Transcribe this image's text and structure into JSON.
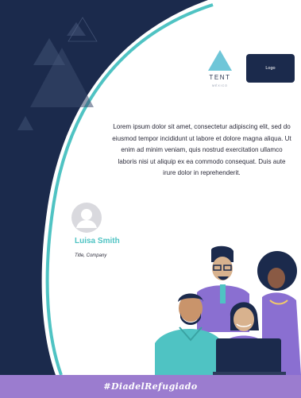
{
  "brand": {
    "name": "TENT",
    "subtitle": "MÉXICO"
  },
  "logo_label": "Logo",
  "body_text": "Lorem ipsum dolor sit amet, consectetur adipiscing elit, sed do eiusmod tempor incididunt ut labore et dolore magna aliqua. Ut enim ad minim veniam, quis nostrud exercitation ullamco laboris nisi ut aliquip ex ea commodo consequat. Duis aute irure dolor in reprehenderit.",
  "person": {
    "name": "Luisa Smith",
    "title": "Title, Company"
  },
  "footer": {
    "hashtag": "#DiadelRefugiado"
  },
  "colors": {
    "navy": "#1b2a4c",
    "teal": "#4fc3c3",
    "purple": "#9b7ccf",
    "brand_triangle": "#6fc6d8"
  },
  "icons": [
    "tent-triangle-icon",
    "avatar-placeholder-icon"
  ],
  "illustration": "group-of-people-at-laptop"
}
